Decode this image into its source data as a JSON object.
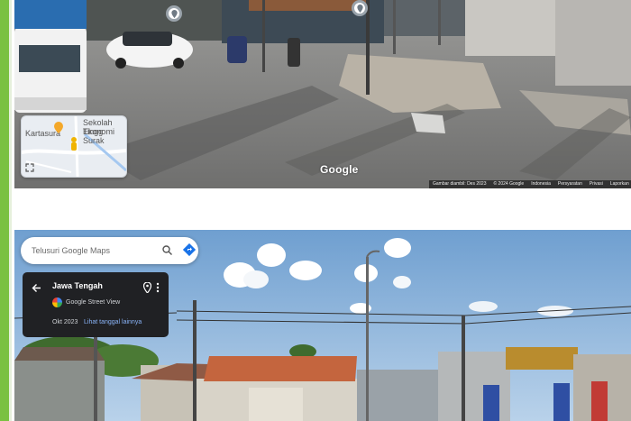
{
  "panel_top": {
    "minimap": {
      "place_label": "Kartasura",
      "poi_label_line1": "Sekolah Tingg",
      "poi_label_line2": "Ekonomi Surak"
    },
    "google_logo": "Google",
    "footer": {
      "image_date": "Gambar diambil: Des 2023",
      "copyright": "© 2024 Google",
      "country": "Indonesia",
      "terms": "Persyaratan",
      "privacy": "Privasi",
      "report": "Laporkan"
    }
  },
  "panel_bottom": {
    "search": {
      "placeholder": "Telusuri Google Maps"
    },
    "info_card": {
      "title": "Jawa Tengah",
      "service": "Google Street View",
      "date": "Okt 2023",
      "more_dates": "Lihat tanggal lainnya"
    }
  },
  "colors": {
    "accent_green": "#7ac142",
    "card_bg": "#202124",
    "link_blue": "#8ab4f8"
  }
}
